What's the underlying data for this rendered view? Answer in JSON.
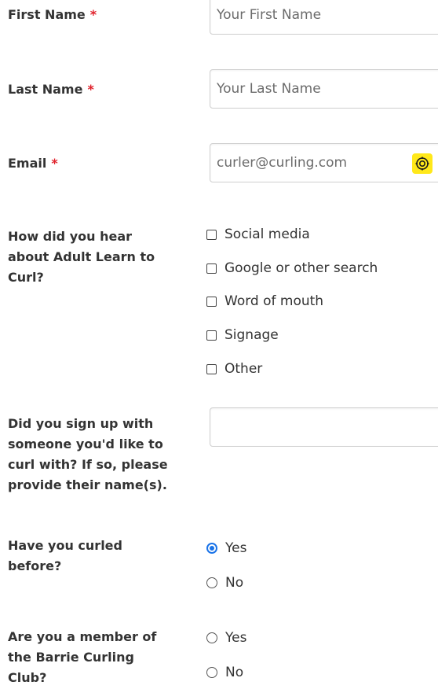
{
  "form": {
    "first_name": {
      "label": "First Name",
      "required_mark": "*",
      "placeholder": "Your First Name",
      "value": ""
    },
    "last_name": {
      "label": "Last Name",
      "required_mark": "*",
      "placeholder": "Your Last Name",
      "value": ""
    },
    "email": {
      "label": "Email",
      "required_mark": "*",
      "placeholder": "curler@curling.com",
      "value": "",
      "autofill_icon": "target-icon",
      "autofill_color": "#ffe81a"
    },
    "hear_about": {
      "label_lines": [
        "How did you hear",
        "about Adult Learn to",
        "Curl?"
      ],
      "options": [
        {
          "label": "Social media",
          "checked": false
        },
        {
          "label": "Google or other search",
          "checked": false
        },
        {
          "label": "Word of mouth",
          "checked": false
        },
        {
          "label": "Signage",
          "checked": false
        },
        {
          "label": "Other",
          "checked": false
        }
      ]
    },
    "partner": {
      "label_lines": [
        "Did you sign up with",
        "someone you'd like to",
        "curl with? If so, please",
        "provide their name(s)."
      ],
      "value": ""
    },
    "curled_before": {
      "label_lines": [
        "Have you curled",
        "before?"
      ],
      "options": [
        {
          "label": "Yes",
          "checked": true
        },
        {
          "label": "No",
          "checked": false
        }
      ]
    },
    "member": {
      "label_lines": [
        "Are you a member of",
        "the Barrie Curling",
        "Club?"
      ],
      "options": [
        {
          "label": "Yes",
          "checked": false
        },
        {
          "label": "No",
          "checked": false
        }
      ]
    }
  },
  "colors": {
    "required": "#e0202a",
    "radio_selected": "#1a73e8",
    "text": "#333333",
    "input_border": "#cfcfcf"
  }
}
